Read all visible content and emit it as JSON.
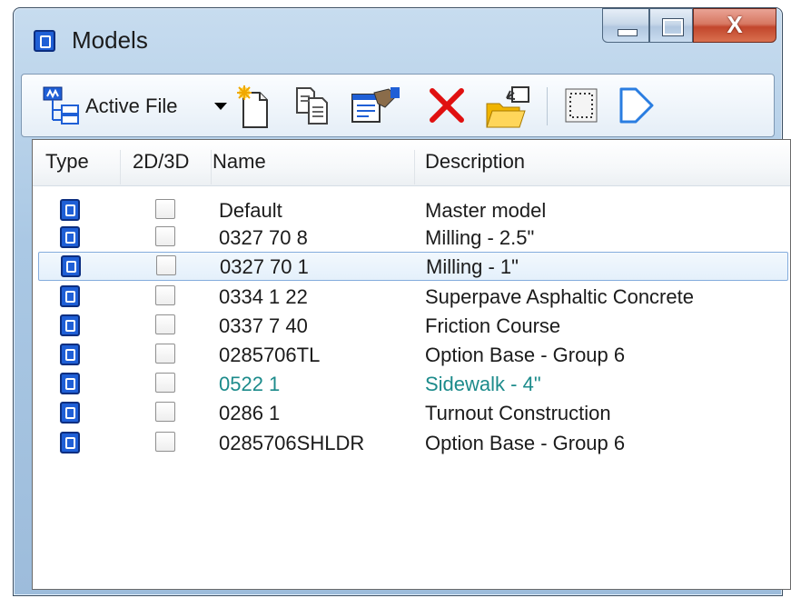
{
  "window": {
    "title": "Models"
  },
  "toolbar": {
    "active_file_label": "Active File",
    "icons": [
      "models-tree-icon",
      "new-model-icon",
      "copy-model-icon",
      "model-properties-icon",
      "delete-icon",
      "import-icon",
      "select-all-icon",
      "shape-icon"
    ]
  },
  "columns": {
    "type": "Type",
    "dim": "2D/3D",
    "name": "Name",
    "description": "Description"
  },
  "rows": [
    {
      "name": "Default",
      "description": "Master model"
    },
    {
      "name": "0327 70  8",
      "description": "Milling - 2.5\""
    },
    {
      "name": "0327 70  1",
      "description": "Milling - 1\""
    },
    {
      "name": "0334  1 22",
      "description": "Superpave Asphaltic Concrete"
    },
    {
      "name": "0337  7 40",
      "description": "Friction Course"
    },
    {
      "name": "0285706TL",
      "description": "Option Base - Group 6"
    },
    {
      "name": "0522  1",
      "description": "Sidewalk - 4\""
    },
    {
      "name": "0286  1",
      "description": "Turnout Construction"
    },
    {
      "name": "0285706SHLDR",
      "description": "Option Base - Group 6"
    }
  ],
  "colors": {
    "model_icon": "#1f5fd6",
    "selection_border": "#84acdd",
    "accent_text": "#1c8b8b",
    "delete_red": "#e01010"
  }
}
